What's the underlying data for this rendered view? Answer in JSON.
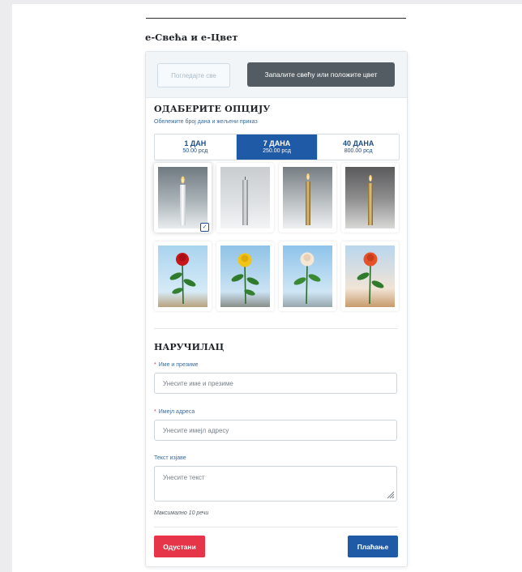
{
  "section": {
    "title": "е-Свећа и е-Цвет"
  },
  "header": {
    "view_all_label": "Погледајте све",
    "light_candle_label": "Запалите свећу или положите цвет"
  },
  "options": {
    "title": "ОДАБЕРИТЕ ОПЦИЈУ",
    "subtitle": "Обележите број дана и жељени приказ",
    "tabs": [
      {
        "days": "1 ДАН",
        "price": "50.00 рсд",
        "selected": false
      },
      {
        "days": "7 ДАНА",
        "price": "250.00 рсд",
        "selected": true
      },
      {
        "days": "40 ДАНА",
        "price": "800.00 рсд",
        "selected": false
      }
    ],
    "items": [
      {
        "icon": "white-candle-image",
        "selected": true
      },
      {
        "icon": "silver-candle-image",
        "selected": false
      },
      {
        "icon": "gold-candle-image",
        "selected": false
      },
      {
        "icon": "gold-candle-dark-image",
        "selected": false
      },
      {
        "icon": "red-rose-image",
        "selected": false
      },
      {
        "icon": "yellow-rose-image",
        "selected": false
      },
      {
        "icon": "white-rose-image",
        "selected": false
      },
      {
        "icon": "orange-rose-image",
        "selected": false
      }
    ]
  },
  "orderer": {
    "title": "НАРУЧИЛАЦ",
    "name_label": "Име и презиме",
    "name_placeholder": "Унесите име и презиме",
    "email_label": "Имејл адреса",
    "email_placeholder": "Унесите имејл адресу",
    "message_label": "Текст изјаве",
    "message_placeholder": "Унесите текст",
    "note": "Максимално 10 речи",
    "required_mark": "*"
  },
  "actions": {
    "cancel_label": "Одустани",
    "pay_label": "Плаћање"
  },
  "colors": {
    "primary": "#1f5aa6",
    "danger": "#e63448",
    "dark_button": "#535c62"
  }
}
